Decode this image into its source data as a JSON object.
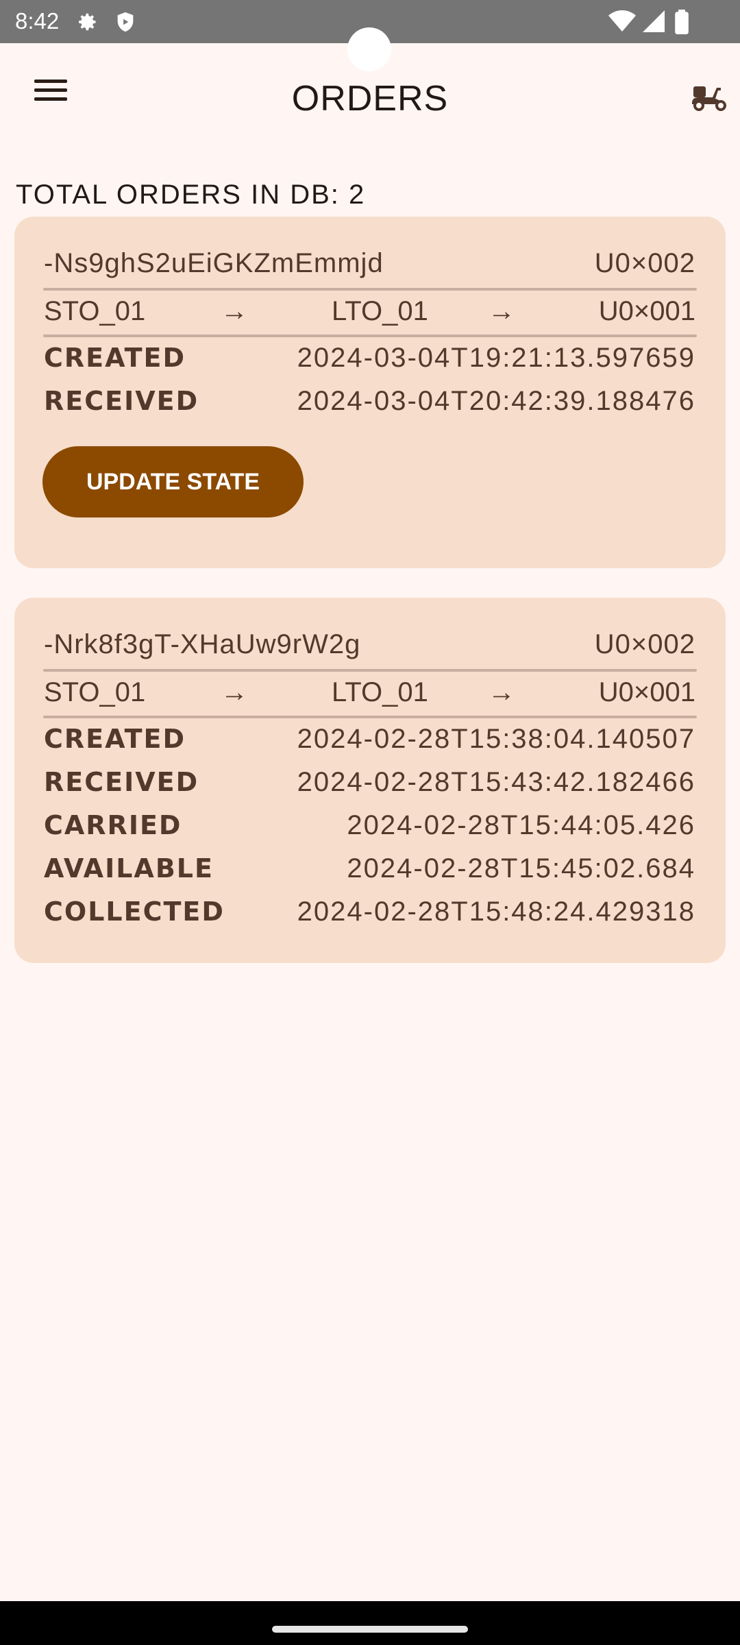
{
  "status_bar": {
    "time": "8:42",
    "icons": [
      "gear-icon",
      "shield-icon",
      "wifi-icon",
      "signal-icon",
      "battery-icon"
    ]
  },
  "header": {
    "title": "ORDERS",
    "menu_icon": "hamburger-menu-icon",
    "action_icon": "scooter-icon"
  },
  "summary": {
    "total_text": "TOTAL ORDERS IN DB: 2"
  },
  "orders": [
    {
      "id": "-Ns9ghS2uEiGKZmEmmjd",
      "user": "U0×002",
      "route": {
        "from": "STO_01",
        "arrow1": "→",
        "via": "LTO_01",
        "arrow2": "→",
        "to": "U0×001"
      },
      "events": [
        {
          "label": "CREATED",
          "value": "2024-03-04T19:21:13.597659"
        },
        {
          "label": "RECEIVED",
          "value": "2024-03-04T20:42:39.188476"
        }
      ],
      "action_label": "UPDATE STATE"
    },
    {
      "id": "-Nrk8f3gT-XHaUw9rW2g",
      "user": "U0×002",
      "route": {
        "from": "STO_01",
        "arrow1": "→",
        "via": "LTO_01",
        "arrow2": "→",
        "to": "U0×001"
      },
      "events": [
        {
          "label": "CREATED",
          "value": "2024-02-28T15:38:04.140507"
        },
        {
          "label": "RECEIVED",
          "value": "2024-02-28T15:43:42.182466"
        },
        {
          "label": "CARRIED",
          "value": "2024-02-28T15:44:05.426"
        },
        {
          "label": "AVAILABLE",
          "value": "2024-02-28T15:45:02.684"
        },
        {
          "label": "COLLECTED",
          "value": "2024-02-28T15:48:24.429318"
        }
      ]
    }
  ],
  "colors": {
    "background": "#FFF6F3",
    "card": "#F7DDCB",
    "button": "#8B4A00",
    "text": "#52392C"
  }
}
